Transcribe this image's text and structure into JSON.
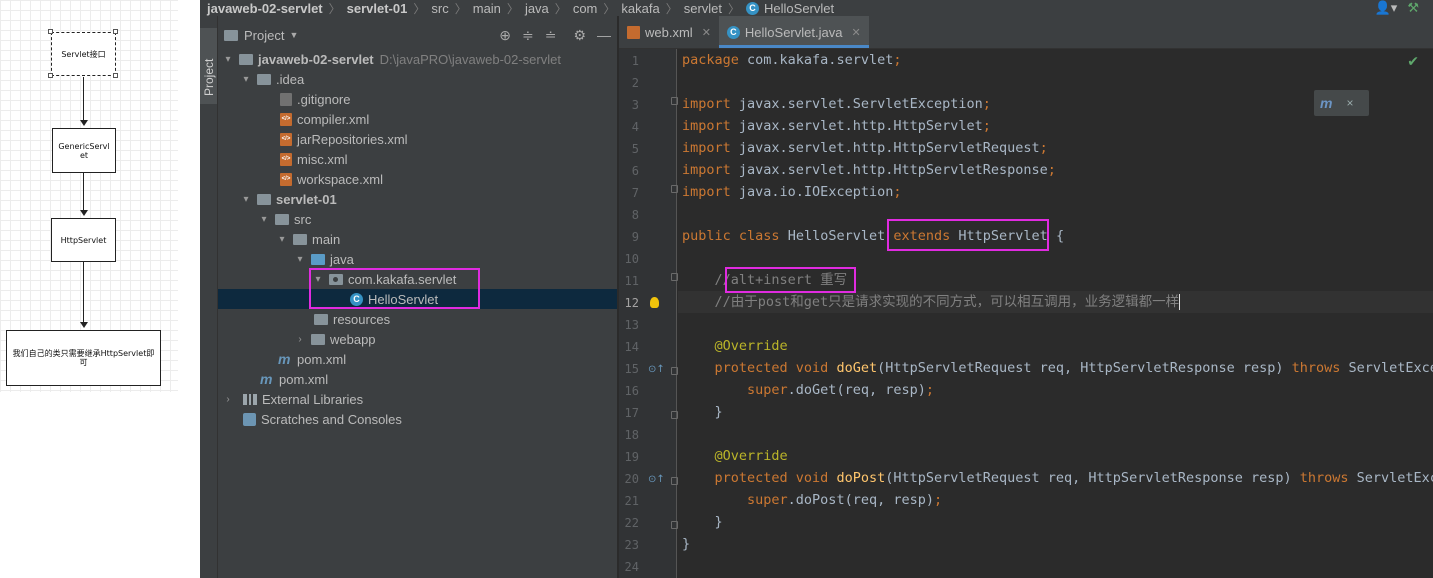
{
  "diagram": {
    "nodes": [
      "Servlet接口",
      "GenericServlet",
      "HttpServlet",
      "我们自己的类只需要继承HttpServlet即可"
    ]
  },
  "navbar": {
    "crumbs": [
      "javaweb-02-servlet",
      "servlet-01",
      "src",
      "main",
      "java",
      "com",
      "kakafa",
      "servlet",
      "HelloServlet"
    ]
  },
  "stripe": {
    "project_tab": "Project"
  },
  "project": {
    "title": "Project",
    "tree": [
      {
        "label": "javaweb-02-servlet",
        "path": "D:\\javaPRO\\javaweb-02-servlet"
      },
      {
        "label": ".idea"
      },
      {
        "label": ".gitignore"
      },
      {
        "label": "compiler.xml"
      },
      {
        "label": "jarRepositories.xml"
      },
      {
        "label": "misc.xml"
      },
      {
        "label": "workspace.xml"
      },
      {
        "label": "servlet-01"
      },
      {
        "label": "src"
      },
      {
        "label": "main"
      },
      {
        "label": "java"
      },
      {
        "label": "com.kakafa.servlet"
      },
      {
        "label": "HelloServlet"
      },
      {
        "label": "resources"
      },
      {
        "label": "webapp"
      },
      {
        "label": "pom.xml"
      },
      {
        "label": "pom.xml"
      },
      {
        "label": "External Libraries"
      },
      {
        "label": "Scratches and Consoles"
      }
    ]
  },
  "editor": {
    "tabs": [
      "web.xml",
      "HelloServlet.java"
    ],
    "active_tab": "HelloServlet.java",
    "line_numbers": [
      "1",
      "2",
      "3",
      "4",
      "5",
      "6",
      "7",
      "8",
      "9",
      "10",
      "11",
      "12",
      "13",
      "14",
      "15",
      "16",
      "17",
      "18",
      "19",
      "20",
      "21",
      "22",
      "23",
      "24"
    ],
    "current_line": "12",
    "code": {
      "l1_kw": "package",
      "l1_rest": " com.kakafa.servlet",
      "imp": "import",
      "l3": " javax.servlet.ServletException",
      "l4": " javax.servlet.http.HttpServlet",
      "l5": " javax.servlet.http.HttpServletRequest",
      "l6": " javax.servlet.http.HttpServletResponse",
      "l7": " java.io.IOException",
      "semi": ";",
      "public": "public",
      "class": "class",
      "classname": " HelloServlet ",
      "extends": "extends",
      "parent": " HttpServlet",
      "brace_open": " {",
      "l11_comment": "//alt+insert 重写",
      "l12_comment": "//由于post和get只是请求实现的不同方式，可以相互调用，业务逻辑都一样",
      "override": "@Override",
      "protected": "protected",
      "void": " void ",
      "doGet": "doGet",
      "doGet_params": "(HttpServletRequest req, HttpServletResponse resp) ",
      "throws": "throws",
      "l15_tail": " ServletExce",
      "super": "super",
      "l16_rest": ".doGet(req, resp)",
      "close_brace": "}",
      "doPost": "doPost",
      "doPost_params": "(HttpServletRequest req, HttpServletResponse resp) ",
      "l20_tail": " ServletExc",
      "l22_rest": ".doPost(req, resp)"
    }
  },
  "popup": {
    "icon": "m",
    "close": "×"
  },
  "colors": {
    "highlight": "#e02be0",
    "keyword": "#cc7832",
    "annotation": "#bbb529",
    "method": "#ffc66d"
  }
}
